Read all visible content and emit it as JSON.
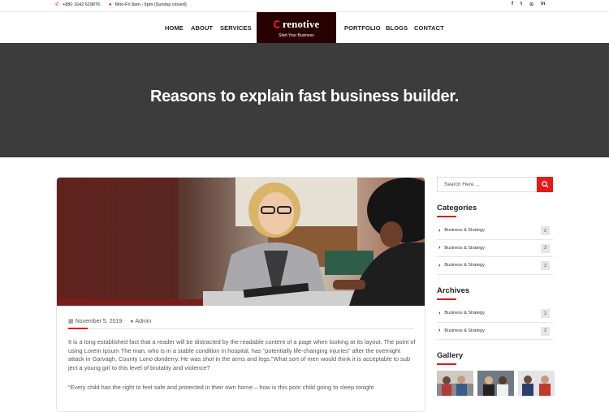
{
  "topbar": {
    "phone": "+880 1642 629876",
    "hours": "Mon-Fri 8am - 6pm (Sunday closed)",
    "social_icons": [
      "facebook-icon",
      "twitter-icon",
      "github-icon",
      "linkedin-icon"
    ],
    "social_glyphs": [
      "f",
      "t",
      "⊙",
      "in"
    ]
  },
  "nav": {
    "left": [
      "HOME",
      "ABOUT",
      "SERVICES"
    ],
    "right": [
      "PORTFOLIO",
      "BLOGS",
      "CONTACT"
    ]
  },
  "logo": {
    "name": "renotive",
    "tagline": "Start Your Business"
  },
  "hero": {
    "title": "Reasons to explain fast business builder."
  },
  "post": {
    "date": "November 5, 2019",
    "author": "Admin",
    "paragraph1": "It is a long established fact that a reader will be distracted by the readable content of a page when looking at its layout. The point of using Lorem Ipsum The man, who is in a stable condition in hospital, has “potentially life-changing injuries” after the overnight attack in Garvagh, County Lono donderry. He was shot in the arms and legs.”What sort of men would think it is acceptable to sub ject a young girl to this level of brutality and violence?",
    "paragraph2": "“Every child has the right to feel safe and protected in their own home – how is this poor child going to sleep tonight"
  },
  "sidebar": {
    "search_placeholder": "Search Here ...",
    "categories_title": "Categories",
    "categories": [
      {
        "label": "Business & Strategy",
        "count": "2"
      },
      {
        "label": "Business & Strategy",
        "count": "2"
      },
      {
        "label": "Business & Strategy",
        "count": "2"
      }
    ],
    "archives_title": "Archives",
    "archives": [
      {
        "label": "Business & Strategy",
        "count": "2"
      },
      {
        "label": "Business & Strategy",
        "count": "2"
      }
    ],
    "gallery_title": "Gallery"
  },
  "colors": {
    "accent": "#d71920",
    "hero_bg": "#3c3c3c",
    "logo_bg": "#290000"
  }
}
